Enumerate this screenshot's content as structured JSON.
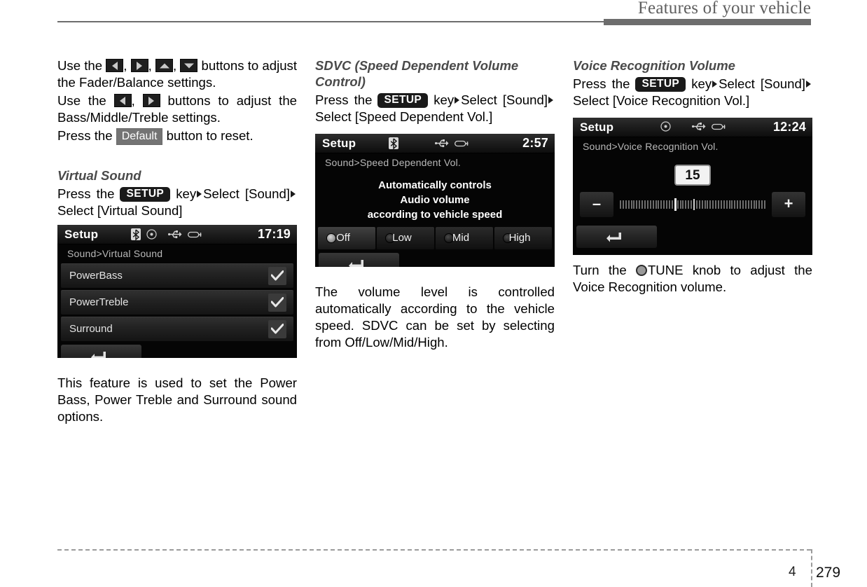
{
  "header": {
    "title": "Features of your vehicle"
  },
  "footer": {
    "chapter": "4",
    "page": "279"
  },
  "icons": {
    "bluetooth": "bluetooth-icon",
    "disc": "disc-icon",
    "usb": "usb-icon",
    "aux": "aux-device-icon",
    "back": "back-arrow-icon",
    "check": "checkmark-icon",
    "tune_knob": "tune-knob-icon"
  },
  "col1": {
    "para1": {
      "t1": "Use the",
      "t2": ",",
      "t3": ",",
      "t4": ",",
      "t5": "buttons to adjust the Fader/Balance settings."
    },
    "para2": {
      "t1": "Use the",
      "t2": ",",
      "t3": "buttons to adjust the Bass/Middle/Treble settings."
    },
    "para3": {
      "t1": "Press the",
      "badge": "Default",
      "t2": "button to reset."
    },
    "section_title": "Virtual Sound",
    "steps": {
      "t1": "Press",
      "t2": "the",
      "badge": "SETUP",
      "t3": "key",
      "t4": "Select [Sound]",
      "t5": "Select [Virtual Sound]"
    },
    "screen": {
      "title": "Setup",
      "clock": "17:19",
      "breadcrumb": "Sound>Virtual Sound",
      "rows": [
        {
          "label": "PowerBass",
          "checked": true
        },
        {
          "label": "PowerTreble",
          "checked": true
        },
        {
          "label": "Surround",
          "checked": true
        }
      ]
    },
    "caption": "This feature is used to set the Power Bass, Power Treble and Surround sound options."
  },
  "col2": {
    "section_title": "SDVC (Speed Dependent Volume Control)",
    "steps": {
      "t1": "Press",
      "t2": "the",
      "badge": "SETUP",
      "t3": "key",
      "t4": "Select [Sound]",
      "t5": "Select [Speed Dependent Vol.]"
    },
    "screen": {
      "title": "Setup",
      "clock": "2:57",
      "breadcrumb": "Sound>Speed Dependent Vol.",
      "message_line1": "Automatically controls",
      "message_line2": "Audio volume",
      "message_line3": "according to vehicle speed",
      "options": [
        {
          "label": "Off",
          "selected": true
        },
        {
          "label": "Low",
          "selected": false
        },
        {
          "label": "Mid",
          "selected": false
        },
        {
          "label": "High",
          "selected": false
        }
      ]
    },
    "caption": "The volume level is controlled automatically according to the vehicle speed. SDVC can be set by selecting from Off/Low/Mid/High."
  },
  "col3": {
    "section_title": "Voice Recognition Volume",
    "steps": {
      "t1": "Press",
      "t2": "the",
      "badge": "SETUP",
      "t3": "key",
      "t4": "Select [Sound]",
      "t5": "Select [Voice Recognition Vol.]"
    },
    "screen": {
      "title": "Setup",
      "clock": "12:24",
      "breadcrumb": "Sound>Voice Recognition Vol.",
      "volume_value": "15",
      "minus_label": "–",
      "plus_label": "+"
    },
    "caption": {
      "t1": "Turn the",
      "t2": "TUNE knob to adjust the Voice Recognition volume."
    }
  }
}
